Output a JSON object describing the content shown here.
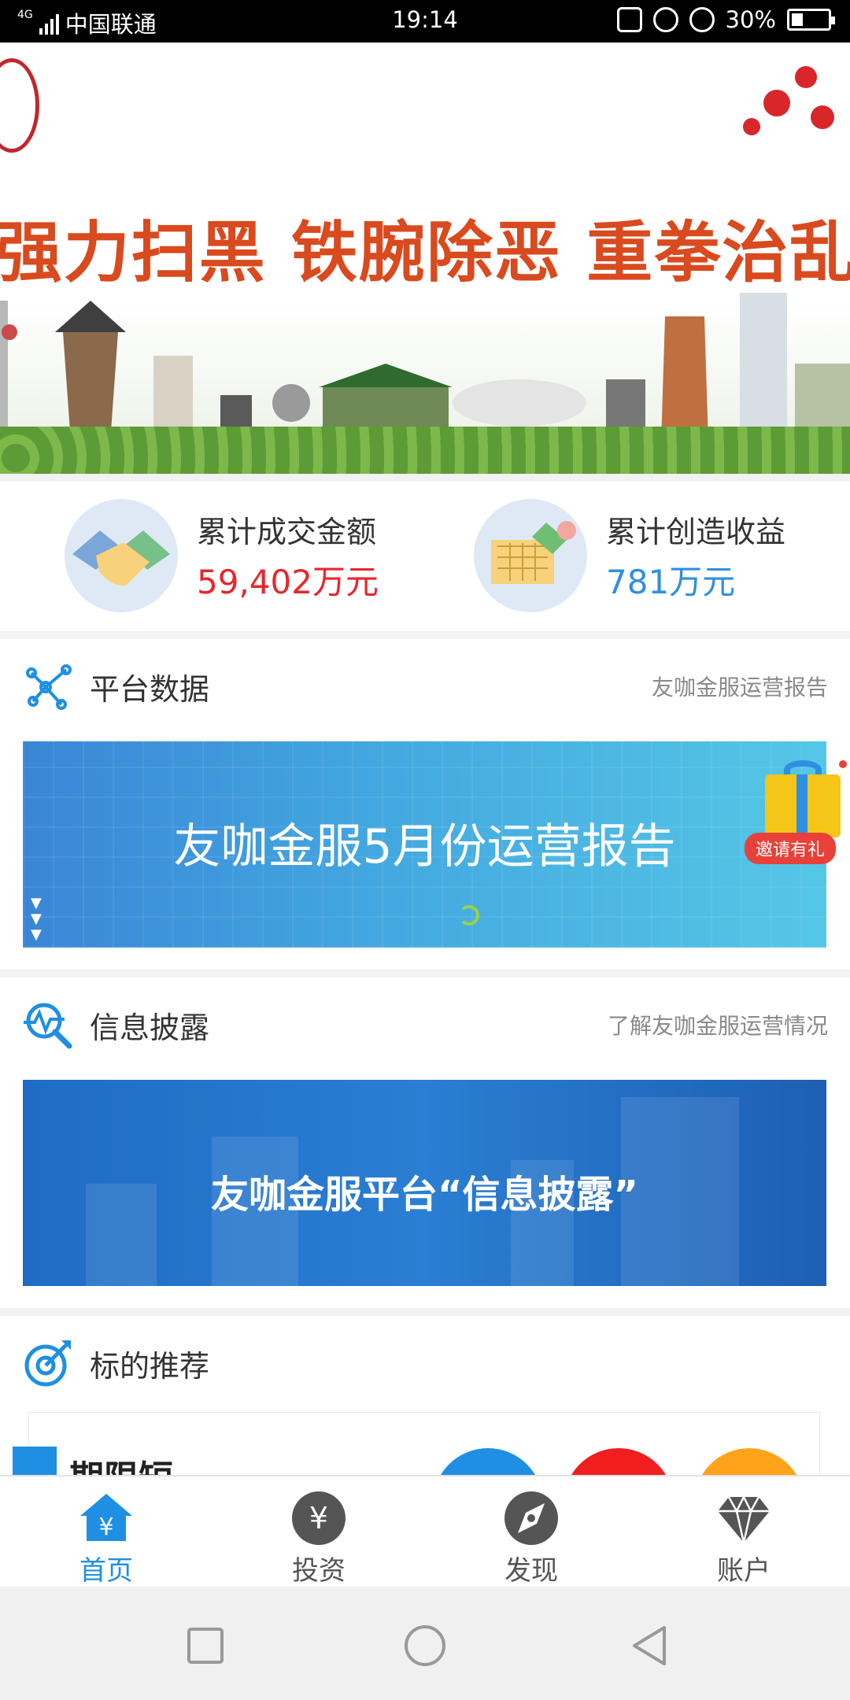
{
  "status_bar": {
    "network": "4G",
    "carrier": "中国联通",
    "time": "19:14",
    "battery": "30%"
  },
  "banner": {
    "slogan": "强力扫黑  铁腕除恶  重拳治乱"
  },
  "stats": [
    {
      "label": "累计成交金额",
      "value": "59,402万元",
      "color": "#e8262b"
    },
    {
      "label": "累计创造收益",
      "value": "781万元",
      "color": "#2f8fe0"
    }
  ],
  "platform_data": {
    "title": "平台数据",
    "link": "友咖金服运营报告",
    "banner_text": "友咖金服5月份运营报告"
  },
  "invite": {
    "label": "邀请有礼"
  },
  "disclosure": {
    "title": "信息披露",
    "link": "了解友咖金服运营情况",
    "banner_text": "友咖金服平台“信息披露”"
  },
  "recommend": {
    "title": "标的推荐",
    "product_name": "期限短"
  },
  "tabs": [
    {
      "label": "首页",
      "icon": "home-icon",
      "active": true
    },
    {
      "label": "投资",
      "icon": "yuan-icon",
      "active": false
    },
    {
      "label": "发现",
      "icon": "compass-icon",
      "active": false
    },
    {
      "label": "账户",
      "icon": "diamond-icon",
      "active": false
    }
  ],
  "colors": {
    "accent": "#1e8fe3",
    "amount_red": "#e8262b",
    "slogan": "#d94a1e"
  }
}
